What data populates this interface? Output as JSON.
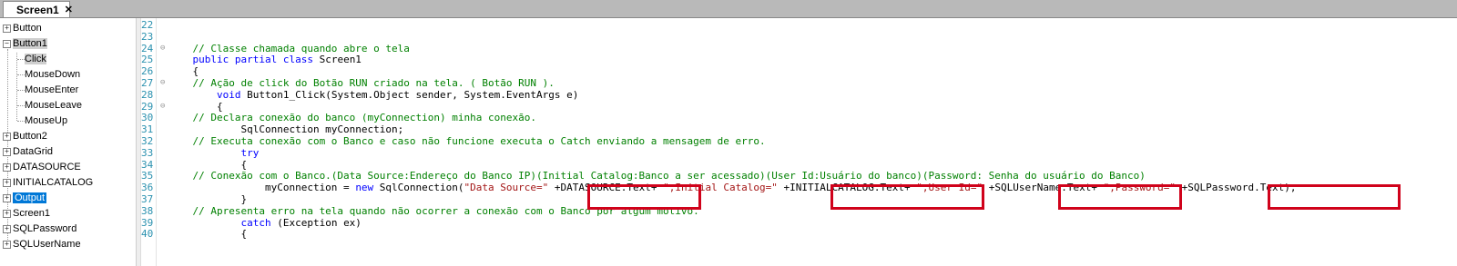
{
  "tab": {
    "label": "Screen1",
    "close": "✕"
  },
  "tree": {
    "items": [
      {
        "label": "Button",
        "expander": "+"
      },
      {
        "label": "Button1",
        "expander": "−"
      },
      {
        "label": "Click"
      },
      {
        "label": "MouseDown"
      },
      {
        "label": "MouseEnter"
      },
      {
        "label": "MouseLeave"
      },
      {
        "label": "MouseUp"
      },
      {
        "label": "Button2",
        "expander": "+"
      },
      {
        "label": "DataGrid",
        "expander": "+"
      },
      {
        "label": "DATASOURCE",
        "expander": "+"
      },
      {
        "label": "INITIALCATALOG",
        "expander": "+"
      },
      {
        "label": "Output",
        "expander": "+"
      },
      {
        "label": "Screen1",
        "expander": "+"
      },
      {
        "label": "SQLPassword",
        "expander": "+"
      },
      {
        "label": "SQLUserName",
        "expander": "+"
      }
    ]
  },
  "editor": {
    "line_numbers": [
      "22",
      "23",
      "24",
      "25",
      "26",
      "27",
      "28",
      "29",
      "30",
      "31",
      "32",
      "33",
      "34",
      "35",
      "36",
      "37",
      "38",
      "39",
      "40"
    ],
    "lines": [
      {
        "t": ""
      },
      {
        "t": ""
      },
      {
        "t": "    // Classe chamada quando abre o tela"
      },
      {
        "kw": "    public partial class",
        "t": " Screen1"
      },
      {
        "t": "    {"
      },
      {
        "t": "    // Ação de click do Botão RUN criado na tela. ( Botão RUN )."
      },
      {
        "kw": "        void",
        "t": " Button1_Click(System.Object sender, System.EventArgs e)"
      },
      {
        "t": "        {"
      },
      {
        "t": "    // Declara conexão do banco (myConnection) minha conexão."
      },
      {
        "t": "            SqlConnection myConnection;"
      },
      {
        "t": "    // Executa conexão com o Banco e caso não funcione executa o Catch enviando a mensagem de erro."
      },
      {
        "kw": "            try",
        "t": ""
      },
      {
        "t": "            {"
      },
      {
        "t": "    // Conexão com o Banco.(Data Source:Endereço do Banco IP)(Initial Catalog:Banco a ser acessado)(User Id:Usuário do banco)(Password: Senha do usuário do Banco)"
      },
      {
        "t": "                myConnection = new SqlConnection(\"Data Source=\" +DATASOURCE.Text+ \";Initial Catalog=\" +INITIALCATALOG.Text+ \";User Id=\" +SQLUserName.Text+ \";Password=\" +SQLPassword.Text);"
      },
      {
        "t": "            }"
      },
      {
        "t": "    // Apresenta erro na tela quando não ocorrer a conexão com o Banco por algum motivo."
      },
      {
        "kw": "            catch",
        "t": " (Exception ex)"
      },
      {
        "t": "            {"
      }
    ],
    "line36": {
      "indent": "                myConnection = ",
      "new": "new",
      "ctor": " SqlConnection(",
      "s1": "\"Data Source=\"",
      "v1": " +DATASOURCE.Text+ ",
      "s2": "\";Initial Catalog=\"",
      "v2": " +INITIALCATALOG.Text+ ",
      "s3": "\";User Id=\"",
      "v3": " +SQLUserName.Text+ ",
      "s4": "\";Password=\"",
      "v4": " +SQLPassword.Text);"
    }
  },
  "colors": {
    "comment": "#008000",
    "keyword": "#0000ff",
    "string": "#a31515",
    "highlight_box": "#d0021b",
    "selection": "#0078d7"
  }
}
